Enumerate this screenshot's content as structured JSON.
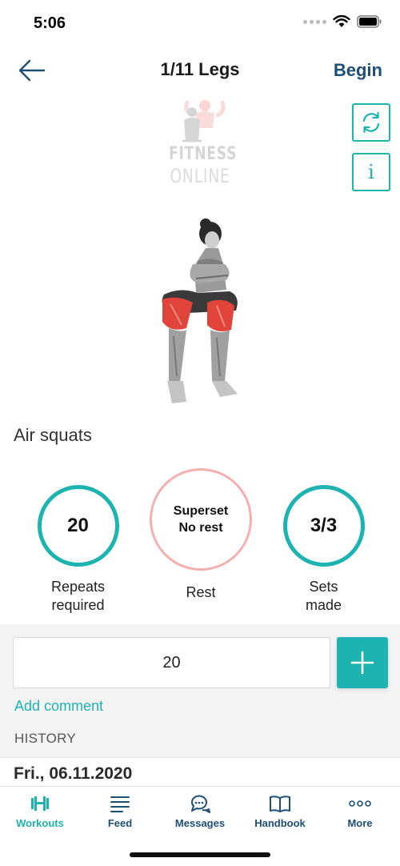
{
  "status_bar": {
    "time": "5:06"
  },
  "header": {
    "title": "1/11 Legs",
    "begin_label": "Begin"
  },
  "side_buttons": {
    "info_label": "i"
  },
  "logo": {
    "line1": "FITNESS",
    "line2": "ONLINE"
  },
  "exercise": {
    "name": "Air squats"
  },
  "stats": {
    "repeats": {
      "value": "20",
      "label_line1": "Repeats",
      "label_line2": "required"
    },
    "rest": {
      "value_line1": "Superset",
      "value_line2": "No rest",
      "label": "Rest"
    },
    "sets": {
      "value": "3/3",
      "label_line1": "Sets",
      "label_line2": "made"
    }
  },
  "input": {
    "value": "20"
  },
  "add_comment_label": "Add comment",
  "history": {
    "label": "HISTORY",
    "date": "Fri., 06.11.2020"
  },
  "tabs": [
    {
      "label": "Workouts",
      "icon": "dumbbell-icon",
      "active": true
    },
    {
      "label": "Feed",
      "icon": "feed-lines-icon",
      "active": false
    },
    {
      "label": "Messages",
      "icon": "chat-bubbles-icon",
      "active": false
    },
    {
      "label": "Handbook",
      "icon": "book-icon",
      "active": false
    },
    {
      "label": "More",
      "icon": "more-dots-icon",
      "active": false
    }
  ],
  "colors": {
    "accent": "#1db3b1",
    "nav_blue": "#1e4f73",
    "rest_pink": "#f4b0b0"
  }
}
